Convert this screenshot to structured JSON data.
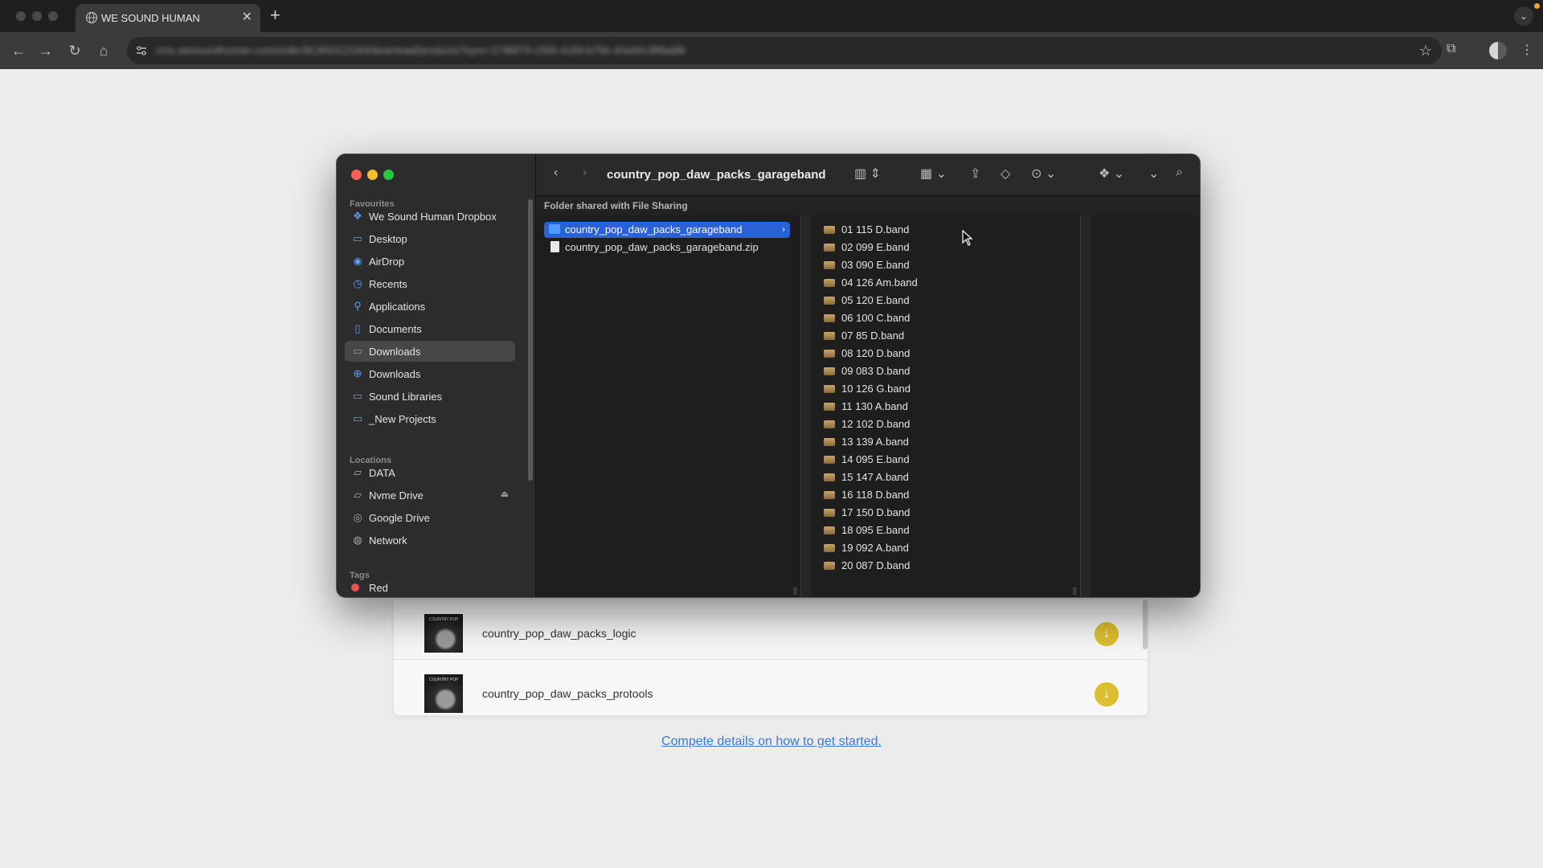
{
  "browser": {
    "tab_title": "WE SOUND HUMAN",
    "tab_close": "✕",
    "new_tab": "+",
    "url": "cms.wesoundhuman.com/order/81365312164/download/products?sync=278bf73-c566-4183-b75b-40a00c3f6ba88",
    "icons": [
      "globe-icon",
      "back-icon",
      "forward-icon",
      "reload-icon",
      "home-icon",
      "site-info-icon",
      "bookmark-star-icon",
      "extensions-icon",
      "profile-icon",
      "menu-icon"
    ]
  },
  "finder": {
    "title": "country_pop_daw_packs_garageband",
    "shared_notice": "Folder shared with File Sharing",
    "sidebar": {
      "favourites_label": "Favourites",
      "favourites": [
        {
          "label": "We Sound Human Dropbox",
          "icon": "dropbox-icon"
        },
        {
          "label": "Desktop",
          "icon": "desktop-icon"
        },
        {
          "label": "AirDrop",
          "icon": "airdrop-icon"
        },
        {
          "label": "Recents",
          "icon": "recents-icon"
        },
        {
          "label": "Applications",
          "icon": "applications-icon"
        },
        {
          "label": "Documents",
          "icon": "document-icon"
        },
        {
          "label": "Downloads",
          "icon": "folder-icon",
          "selected": true
        },
        {
          "label": "Downloads",
          "icon": "downloads-icon"
        },
        {
          "label": "Sound Libraries",
          "icon": "folder-icon"
        },
        {
          "label": "_New Projects",
          "icon": "folder-icon"
        }
      ],
      "locations_label": "Locations",
      "locations": [
        {
          "label": "DATA",
          "icon": "drive-icon"
        },
        {
          "label": "Nvme Drive",
          "icon": "drive-icon",
          "eject": "⏏"
        },
        {
          "label": "Google Drive",
          "icon": "cloud-drive-icon"
        },
        {
          "label": "Network",
          "icon": "network-icon"
        }
      ],
      "tags_label": "Tags",
      "tags": [
        {
          "label": "Red",
          "color": "#e8524f"
        }
      ]
    },
    "column1": [
      {
        "label": "country_pop_daw_packs_garageband",
        "type": "folder",
        "selected": true
      },
      {
        "label": "country_pop_daw_packs_garageband.zip",
        "type": "zip"
      }
    ],
    "column2": [
      "01 115 D.band",
      "02 099 E.band",
      "03 090 E.band",
      "04 126 Am.band",
      "05 120 E.band",
      "06 100 C.band",
      "07 85 D.band",
      "08 120 D.band",
      "09 083 D.band",
      "10 126 G.band",
      "11 130 A.band",
      "12 102 D.band",
      "13 139 A.band",
      "14 095 E.band",
      "15 147 A.band",
      "16 118 D.band",
      "17 150 D.band",
      "18 095 E.band",
      "19 092 A.band",
      "20 087 D.band"
    ]
  },
  "page": {
    "downloads": [
      {
        "name": "country_pop_daw_packs_logic",
        "thumb_text": "COUNTRY POP"
      },
      {
        "name": "country_pop_daw_packs_protools",
        "thumb_text": "COUNTRY POP"
      }
    ],
    "start_link": "Compete details on how to get started."
  },
  "colors": {
    "selection": "#2861d8",
    "download_button": "#dcbf2e",
    "link": "#3a7bd5"
  }
}
